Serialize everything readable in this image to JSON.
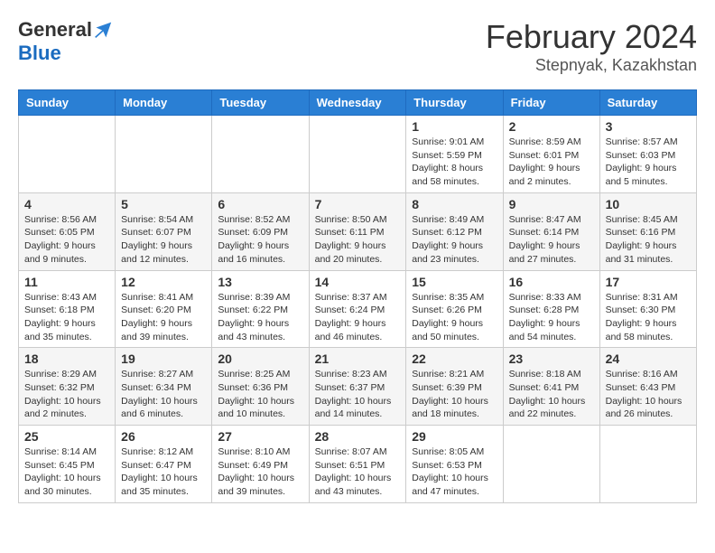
{
  "header": {
    "logo_general": "General",
    "logo_blue": "Blue",
    "month_year": "February 2024",
    "location": "Stepnyak, Kazakhstan"
  },
  "weekdays": [
    "Sunday",
    "Monday",
    "Tuesday",
    "Wednesday",
    "Thursday",
    "Friday",
    "Saturday"
  ],
  "weeks": [
    [
      {
        "day": "",
        "info": ""
      },
      {
        "day": "",
        "info": ""
      },
      {
        "day": "",
        "info": ""
      },
      {
        "day": "",
        "info": ""
      },
      {
        "day": "1",
        "info": "Sunrise: 9:01 AM\nSunset: 5:59 PM\nDaylight: 8 hours\nand 58 minutes."
      },
      {
        "day": "2",
        "info": "Sunrise: 8:59 AM\nSunset: 6:01 PM\nDaylight: 9 hours\nand 2 minutes."
      },
      {
        "day": "3",
        "info": "Sunrise: 8:57 AM\nSunset: 6:03 PM\nDaylight: 9 hours\nand 5 minutes."
      }
    ],
    [
      {
        "day": "4",
        "info": "Sunrise: 8:56 AM\nSunset: 6:05 PM\nDaylight: 9 hours\nand 9 minutes."
      },
      {
        "day": "5",
        "info": "Sunrise: 8:54 AM\nSunset: 6:07 PM\nDaylight: 9 hours\nand 12 minutes."
      },
      {
        "day": "6",
        "info": "Sunrise: 8:52 AM\nSunset: 6:09 PM\nDaylight: 9 hours\nand 16 minutes."
      },
      {
        "day": "7",
        "info": "Sunrise: 8:50 AM\nSunset: 6:11 PM\nDaylight: 9 hours\nand 20 minutes."
      },
      {
        "day": "8",
        "info": "Sunrise: 8:49 AM\nSunset: 6:12 PM\nDaylight: 9 hours\nand 23 minutes."
      },
      {
        "day": "9",
        "info": "Sunrise: 8:47 AM\nSunset: 6:14 PM\nDaylight: 9 hours\nand 27 minutes."
      },
      {
        "day": "10",
        "info": "Sunrise: 8:45 AM\nSunset: 6:16 PM\nDaylight: 9 hours\nand 31 minutes."
      }
    ],
    [
      {
        "day": "11",
        "info": "Sunrise: 8:43 AM\nSunset: 6:18 PM\nDaylight: 9 hours\nand 35 minutes."
      },
      {
        "day": "12",
        "info": "Sunrise: 8:41 AM\nSunset: 6:20 PM\nDaylight: 9 hours\nand 39 minutes."
      },
      {
        "day": "13",
        "info": "Sunrise: 8:39 AM\nSunset: 6:22 PM\nDaylight: 9 hours\nand 43 minutes."
      },
      {
        "day": "14",
        "info": "Sunrise: 8:37 AM\nSunset: 6:24 PM\nDaylight: 9 hours\nand 46 minutes."
      },
      {
        "day": "15",
        "info": "Sunrise: 8:35 AM\nSunset: 6:26 PM\nDaylight: 9 hours\nand 50 minutes."
      },
      {
        "day": "16",
        "info": "Sunrise: 8:33 AM\nSunset: 6:28 PM\nDaylight: 9 hours\nand 54 minutes."
      },
      {
        "day": "17",
        "info": "Sunrise: 8:31 AM\nSunset: 6:30 PM\nDaylight: 9 hours\nand 58 minutes."
      }
    ],
    [
      {
        "day": "18",
        "info": "Sunrise: 8:29 AM\nSunset: 6:32 PM\nDaylight: 10 hours\nand 2 minutes."
      },
      {
        "day": "19",
        "info": "Sunrise: 8:27 AM\nSunset: 6:34 PM\nDaylight: 10 hours\nand 6 minutes."
      },
      {
        "day": "20",
        "info": "Sunrise: 8:25 AM\nSunset: 6:36 PM\nDaylight: 10 hours\nand 10 minutes."
      },
      {
        "day": "21",
        "info": "Sunrise: 8:23 AM\nSunset: 6:37 PM\nDaylight: 10 hours\nand 14 minutes."
      },
      {
        "day": "22",
        "info": "Sunrise: 8:21 AM\nSunset: 6:39 PM\nDaylight: 10 hours\nand 18 minutes."
      },
      {
        "day": "23",
        "info": "Sunrise: 8:18 AM\nSunset: 6:41 PM\nDaylight: 10 hours\nand 22 minutes."
      },
      {
        "day": "24",
        "info": "Sunrise: 8:16 AM\nSunset: 6:43 PM\nDaylight: 10 hours\nand 26 minutes."
      }
    ],
    [
      {
        "day": "25",
        "info": "Sunrise: 8:14 AM\nSunset: 6:45 PM\nDaylight: 10 hours\nand 30 minutes."
      },
      {
        "day": "26",
        "info": "Sunrise: 8:12 AM\nSunset: 6:47 PM\nDaylight: 10 hours\nand 35 minutes."
      },
      {
        "day": "27",
        "info": "Sunrise: 8:10 AM\nSunset: 6:49 PM\nDaylight: 10 hours\nand 39 minutes."
      },
      {
        "day": "28",
        "info": "Sunrise: 8:07 AM\nSunset: 6:51 PM\nDaylight: 10 hours\nand 43 minutes."
      },
      {
        "day": "29",
        "info": "Sunrise: 8:05 AM\nSunset: 6:53 PM\nDaylight: 10 hours\nand 47 minutes."
      },
      {
        "day": "",
        "info": ""
      },
      {
        "day": "",
        "info": ""
      }
    ]
  ]
}
